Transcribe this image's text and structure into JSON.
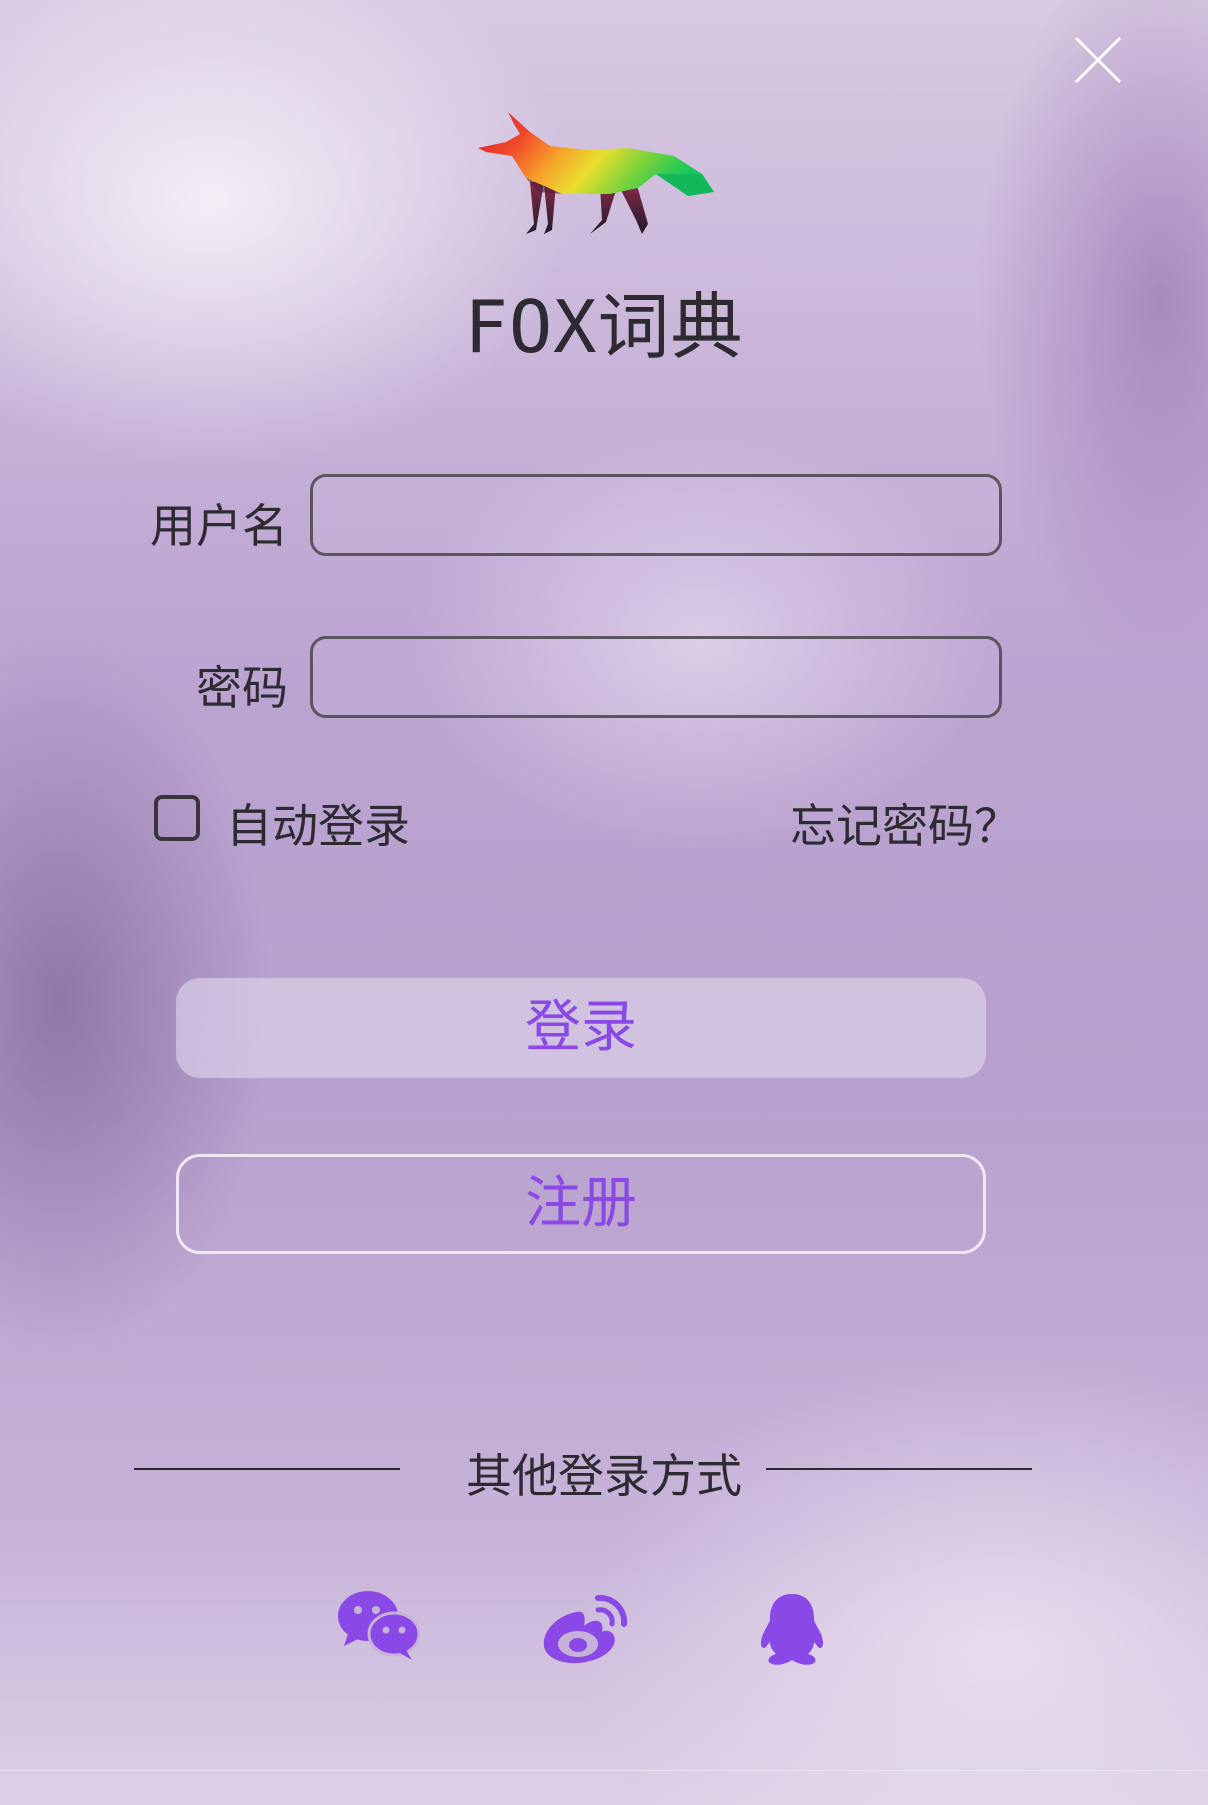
{
  "app": {
    "title": "FOX词典"
  },
  "form": {
    "username_label": "用户名",
    "username_value": "",
    "password_label": "密码",
    "password_value": "",
    "auto_login_label": "自动登录",
    "forgot_password_label": "忘记密码？"
  },
  "buttons": {
    "login_label": "登录",
    "register_label": "注册"
  },
  "other_login": {
    "title": "其他登录方式",
    "providers": [
      {
        "icon": "wechat-icon"
      },
      {
        "icon": "weibo-icon"
      },
      {
        "icon": "qq-icon"
      }
    ]
  },
  "colors": {
    "accent": "#8a48e6",
    "text": "#2e2a31",
    "background": "#b89fcd"
  },
  "icons": {
    "close": "close-icon",
    "logo": "fox-logo-icon"
  }
}
